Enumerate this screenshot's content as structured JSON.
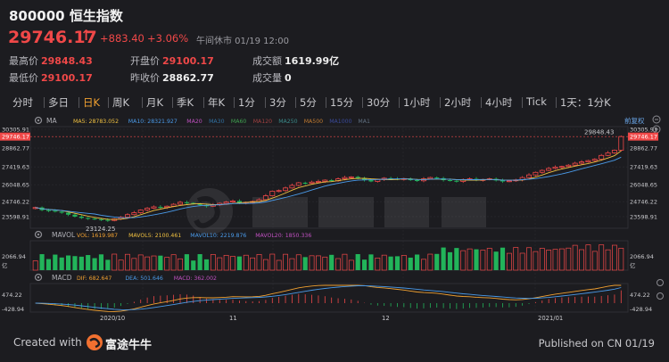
{
  "header": {
    "symbol": "800000",
    "name": "恒生指数",
    "price": "29746.17",
    "arrow": "↑",
    "change": "+883.40",
    "change_pct": "+3.06%",
    "status": "午间休市 01/19 12:00"
  },
  "stats": {
    "high_label": "最高价",
    "high": "29848.43",
    "open_label": "开盘价",
    "open": "29100.17",
    "turnover_label": "成交额",
    "turnover": "1619.99亿",
    "low_label": "最低价",
    "low": "29100.17",
    "prev_close_label": "昨收价",
    "prev_close": "28862.77",
    "volume_label": "成交量",
    "volume": "0"
  },
  "tabs": [
    "分时",
    "多日",
    "日K",
    "周K",
    "月K",
    "季K",
    "年K",
    "1分",
    "3分",
    "5分",
    "15分",
    "30分",
    "1小时",
    "2小时",
    "4小时",
    "Tick",
    "1天：1分K"
  ],
  "active_tab": "日K",
  "main_chart": {
    "label": "MA",
    "ma_items": [
      {
        "text": "MA5: 28783.052",
        "color": "#f0c040"
      },
      {
        "text": "MA10: 28321.927",
        "color": "#4a9ae8"
      },
      {
        "text": "MA20",
        "color": "#c050c0"
      },
      {
        "text": "MA30",
        "color": "#3070a0"
      },
      {
        "text": "MA60",
        "color": "#40a050"
      },
      {
        "text": "MA120",
        "color": "#a04040"
      },
      {
        "text": "MA250",
        "color": "#3a8a8a"
      },
      {
        "text": "MA500",
        "color": "#c07a30"
      },
      {
        "text": "MA1000",
        "color": "#3a4a9a"
      },
      {
        "text": "MA1",
        "color": "#607080"
      }
    ],
    "adjust_label": "前复权",
    "y_ticks": [
      "30305.91",
      "29746.17",
      "28862.77",
      "27419.63",
      "26048.65",
      "24746.22",
      "23598.91"
    ],
    "high_annotation": "29848.43",
    "low_annotation": "23124.25",
    "price_tag": "29746.17"
  },
  "volume_panel": {
    "label": "MAVOL",
    "items": [
      {
        "text": "VOL: 1619.987",
        "color": "#f0a030"
      },
      {
        "text": "MAVOL5: 2100.461",
        "color": "#f0c040"
      },
      {
        "text": "MAVOL10: 2219.876",
        "color": "#4a9ae8"
      },
      {
        "text": "MAVOL20: 1850.336",
        "color": "#c050c0"
      }
    ],
    "y_ticks": [
      "2066.94",
      "亿"
    ]
  },
  "macd_panel": {
    "label": "MACD",
    "items": [
      {
        "text": "DIF: 682.647",
        "color": "#f0a030"
      },
      {
        "text": "DEA: 501.646",
        "color": "#4a9ae8"
      },
      {
        "text": "MACD: 362.002",
        "color": "#c050c0"
      }
    ],
    "y_ticks": [
      "474.22",
      "-428.94"
    ]
  },
  "x_labels": [
    "2020/10",
    "11",
    "12",
    "2021/01"
  ],
  "footer": {
    "created_with": "Created with",
    "brand": "富途牛牛",
    "published": "Published on CN 01/19"
  },
  "chart_data": {
    "type": "candlestick",
    "y_range": [
      23124.25,
      30305.91
    ],
    "high": 29848.43,
    "low": 23124.25,
    "last_close": 29746.17,
    "x_labels": [
      "2020/10",
      "11",
      "12",
      "2021/01"
    ],
    "closes": [
      24300,
      24100,
      24050,
      23980,
      23900,
      23750,
      23600,
      23500,
      23450,
      23400,
      23350,
      23300,
      23420,
      23560,
      23750,
      23900,
      24100,
      24250,
      24350,
      24300,
      24400,
      24550,
      24700,
      24650,
      24580,
      24490,
      24400,
      24500,
      24620,
      24720,
      24800,
      24650,
      24700,
      24760,
      24900,
      25200,
      25550,
      25600,
      25800,
      26000,
      26200,
      26150,
      26250,
      26300,
      26400,
      26350,
      26500,
      26600,
      26650,
      26550,
      26400,
      26300,
      26450,
      26550,
      26500,
      26480,
      26520,
      26400,
      26350,
      26500,
      26600,
      26550,
      26400,
      26350,
      26300,
      26450,
      26500,
      26400,
      26450,
      26500,
      26380,
      26300,
      26350,
      26420,
      26600,
      26800,
      27000,
      27150,
      27300,
      27400,
      27450,
      27550,
      27700,
      27800,
      27900,
      28000,
      28300,
      28500,
      28700,
      29746
    ],
    "volume_max": 2066.94,
    "macd_range": [
      -428.94,
      474.22
    ]
  }
}
